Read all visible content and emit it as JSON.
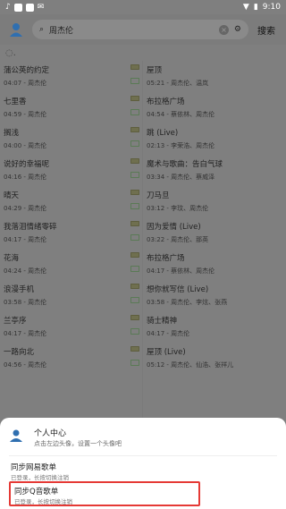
{
  "status": {
    "time": "9:10"
  },
  "header": {
    "search_value": "周杰伦",
    "search_button": "搜索"
  },
  "songs_left": [
    {
      "title": "蒲公英的约定",
      "sub": "04:07 - 周杰伦"
    },
    {
      "title": "七里香",
      "sub": "04:59 - 周杰伦"
    },
    {
      "title": "搁浅",
      "sub": "04:00 - 周杰伦"
    },
    {
      "title": "说好的幸福呢",
      "sub": "04:16 - 周杰伦"
    },
    {
      "title": "晴天",
      "sub": "04:29 - 周杰伦"
    },
    {
      "title": "我落泪情绪零碎",
      "sub": "04:17 - 周杰伦"
    },
    {
      "title": "花海",
      "sub": "04:24 - 周杰伦"
    },
    {
      "title": "浪漫手机",
      "sub": "03:58 - 周杰伦"
    },
    {
      "title": "兰亭序",
      "sub": "04:17 - 周杰伦"
    },
    {
      "title": "一路向北",
      "sub": "04:56 - 周杰伦"
    }
  ],
  "songs_right": [
    {
      "title": "屋顶",
      "sub": "05:21 - 周杰伦、温岚"
    },
    {
      "title": "布拉格广场",
      "sub": "04:54 - 蔡依林、周杰伦"
    },
    {
      "title": "跳 (Live)",
      "sub": "02:13 - 李荣浩、周杰伦"
    },
    {
      "title": "魔术与歌曲：告白气球",
      "sub": "03:34 - 周杰伦、蔡威泽"
    },
    {
      "title": "刀马旦",
      "sub": "03:12 - 李玟、周杰伦"
    },
    {
      "title": "因为爱情 (Live)",
      "sub": "03:22 - 周杰伦、那英"
    },
    {
      "title": "布拉格广场",
      "sub": "04:17 - 蔡依林、周杰伦"
    },
    {
      "title": "想你就写信 (Live)",
      "sub": "03:58 - 周杰伦、李炫、张燕"
    },
    {
      "title": "骑士精神",
      "sub": "04:17 - 周杰伦"
    },
    {
      "title": "屋顶 (Live)",
      "sub": "05:12 - 周杰伦、仙浩、张祥儿"
    }
  ],
  "sheet": {
    "profile_title": "个人中心",
    "profile_sub": "点击左边头像，设置一个头像吧",
    "netease_title": "同步网易歌单",
    "netease_sub": "已登录，长按切换注销",
    "qq_title": "同步Q音歌单",
    "qq_sub": "已登录，长按切换注销"
  }
}
